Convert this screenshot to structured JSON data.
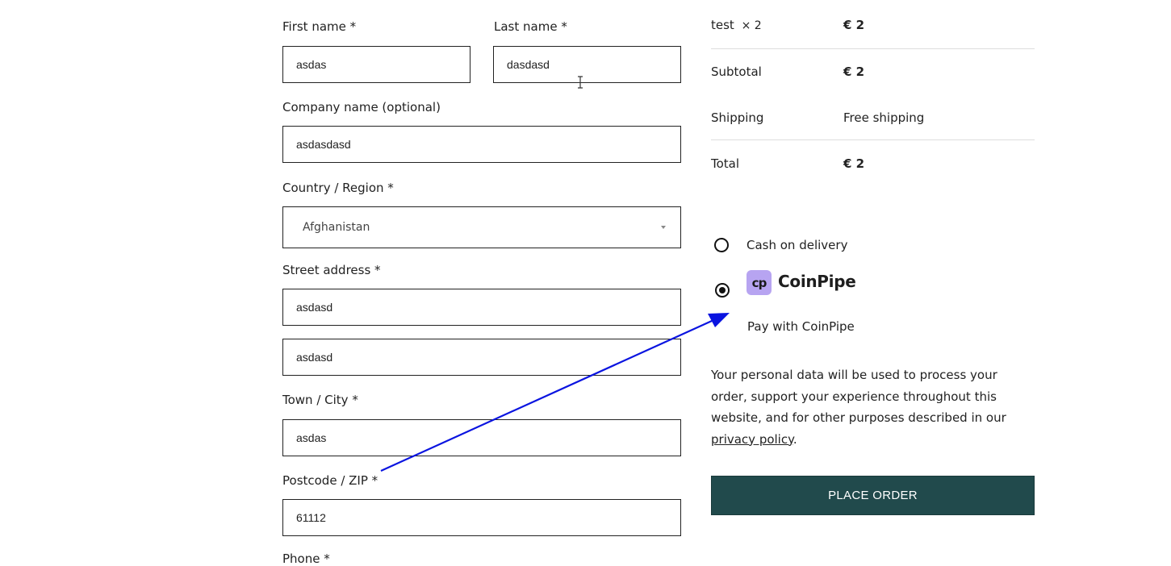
{
  "billing": {
    "first_name_label": "First name *",
    "first_name_value": "asdas",
    "last_name_label": "Last name *",
    "last_name_value": "dasdasd",
    "company_label": "Company name (optional)",
    "company_value": "asdasdasd",
    "country_label": "Country / Region *",
    "country_value": "Afghanistan",
    "street_label": "Street address *",
    "street_value_1": "asdasd",
    "street_value_2": "asdasd",
    "city_label": "Town / City *",
    "city_value": "asdas",
    "postcode_label": "Postcode / ZIP *",
    "postcode_value": "61112",
    "phone_label": "Phone *"
  },
  "order_summary": {
    "item_name": "test",
    "item_qty": "× 2",
    "item_total": "€ 2",
    "subtotal_label": "Subtotal",
    "subtotal_value": "€ 2",
    "shipping_label": "Shipping",
    "shipping_value": "Free shipping",
    "total_label": "Total",
    "total_value": "€ 2"
  },
  "payment": {
    "cod_label": "Cash on delivery",
    "coinpipe_logo_text": "cp",
    "coinpipe_brand": "CoinPipe",
    "coinpipe_description": "Pay with CoinPipe",
    "selected": "coinpipe"
  },
  "privacy": {
    "text": "Your personal data will be used to process your order, support your experience throughout this website, and for other purposes described in our ",
    "link_text": "privacy policy",
    "after": "."
  },
  "place_order_label": "PLACE ORDER",
  "colors": {
    "button_bg": "#214a4c",
    "coinpipe_logo_bg": "#b7a4f1",
    "annotation_arrow": "#0a14e0"
  }
}
